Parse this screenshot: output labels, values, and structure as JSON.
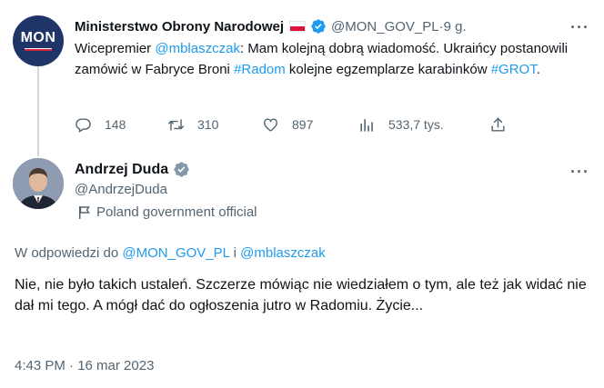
{
  "parent": {
    "name": "Ministerstwo Obrony Narodowej",
    "handle": "@MON_GOV_PL",
    "separator": " · ",
    "time": "9 g.",
    "avatar_text": "MON",
    "text_parts": [
      "Wicepremier ",
      "@mblaszczak",
      ": Mam kolejną dobrą wiadomość. Ukraińcy postanowili zamówić w Fabryce Broni ",
      "#Radom",
      " kolejne egzemplarze karabinków ",
      "#GROT",
      "."
    ],
    "stats": {
      "replies": "148",
      "retweets": "310",
      "likes": "897",
      "views": "533,7 tys."
    },
    "more_label": "···"
  },
  "reply": {
    "name": "Andrzej Duda",
    "handle": "@AndrzejDuda",
    "label": "Poland government official",
    "replying_prefix": "W odpowiedzi do ",
    "replying_user1": "@MON_GOV_PL",
    "replying_join": " i ",
    "replying_user2": "@mblaszczak",
    "text": "Nie, nie było takich ustaleń. Szczerze mówiąc nie wiedziałem o tym, ale też jak widać nie dał mi tego. A mógł dać do ogłoszenia jutro w Radomiu. Życie...",
    "timestamp": "4:43 PM · 16 mar 2023",
    "more_label": "···"
  },
  "colors": {
    "link": "#1d9bf0",
    "secondary_text": "#536471",
    "verified": "#1d9bf0",
    "thread_line": "#cfd9de",
    "mon_avatar_bg": "#1f3567"
  },
  "icons": {
    "reply": "reply-icon",
    "retweet": "retweet-icon",
    "like": "heart-icon",
    "views": "views-icon",
    "share": "share-icon",
    "verified": "verified-badge-icon",
    "label": "government-flag-icon"
  }
}
